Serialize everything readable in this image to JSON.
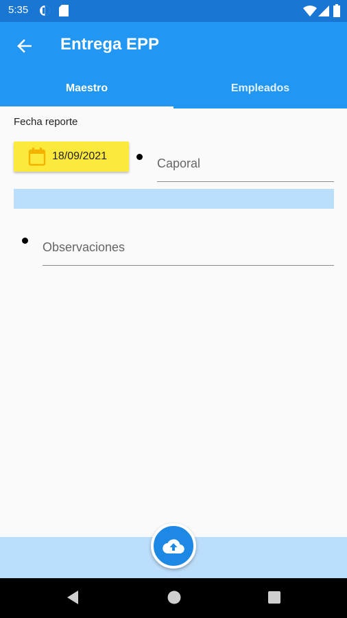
{
  "status_bar": {
    "time": "5:35",
    "left_icons": [
      "do-not-disturb-icon",
      "sd-card-icon"
    ],
    "right_icons": [
      "wifi-icon",
      "signal-icon",
      "battery-icon"
    ]
  },
  "app_bar": {
    "title": "Entrega EPP",
    "back_icon": "arrow-back-icon"
  },
  "tabs": [
    {
      "label": "Maestro",
      "selected": true
    },
    {
      "label": "Empleados",
      "selected": false
    }
  ],
  "form": {
    "fecha_label": "Fecha reporte",
    "date_value": "18/09/2021",
    "caporal_placeholder": "Caporal",
    "caporal_value": "",
    "observaciones_placeholder": "Observaciones",
    "observaciones_value": ""
  },
  "fab": {
    "icon": "cloud-upload-icon"
  },
  "navigation": [
    "back-triangle-icon",
    "home-circle-icon",
    "recents-square-icon"
  ],
  "colors": {
    "primary": "#2196f3",
    "status_bar": "#1976d2",
    "date_button": "#fde93b",
    "light_blue": "#bbdefb",
    "fab": "#1e88e5"
  }
}
